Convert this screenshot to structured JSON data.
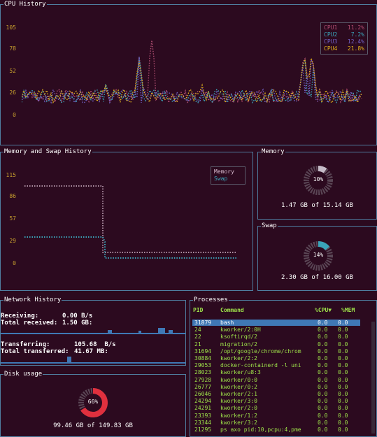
{
  "cpu": {
    "title": "CPU History",
    "yticks": [
      "105",
      "78",
      "52",
      "26",
      "0"
    ],
    "legend": [
      {
        "name": "CPU1",
        "value": "11.2%",
        "color": "#b14e72"
      },
      {
        "name": "CPU2",
        "value": "7.2%",
        "color": "#3aa3b8"
      },
      {
        "name": "CPU3",
        "value": "12.4%",
        "color": "#7161c4"
      },
      {
        "name": "CPU4",
        "value": "21.8%",
        "color": "#e0b01c"
      }
    ]
  },
  "memswap": {
    "title": "Memory and Swap History",
    "yticks": [
      "115",
      "86",
      "57",
      "29",
      "0"
    ],
    "legend": [
      {
        "name": "Memory",
        "color": "#d9bcd0"
      },
      {
        "name": "Swap",
        "color": "#3aa3b8"
      }
    ]
  },
  "memory": {
    "title": "Memory",
    "percent": "10%",
    "used": "1.47 GB of 15.14 GB",
    "fraction": 0.1,
    "color": "#c6bcc8"
  },
  "swap": {
    "title": "Swap",
    "percent": "14%",
    "used": "2.30 GB of 16.00 GB",
    "fraction": 0.14,
    "color": "#3aa3b8"
  },
  "network": {
    "title": "Network History",
    "receiving_label": "Receiving:",
    "receiving_value": "0.00 B/s",
    "total_received_label": "Total received:",
    "total_received_value": "1.50 GB:",
    "transferring_label": "Transferring:",
    "transferring_value": "105.68  B/s",
    "total_transferred_label": "Total transferred:",
    "total_transferred_value": "41.67 MB:"
  },
  "disk": {
    "title": "Disk usage",
    "percent": "66%",
    "used": "99.46 GB of 149.83 GB",
    "fraction": 0.66,
    "color": "#e0303e"
  },
  "processes": {
    "title": "Processes",
    "columns": {
      "pid": "PID",
      "command": "Command",
      "cpu": "%CPU▼",
      "mem": "%MEM"
    },
    "rows": [
      {
        "pid": "31879",
        "command": "bash",
        "cpu": "0.0",
        "mem": "0.0"
      },
      {
        "pid": "24",
        "command": "kworker/2:0H",
        "cpu": "0.0",
        "mem": "0.0"
      },
      {
        "pid": "22",
        "command": "ksoftirqd/2",
        "cpu": "0.0",
        "mem": "0.0"
      },
      {
        "pid": "21",
        "command": "migration/2",
        "cpu": "0.0",
        "mem": "0.0"
      },
      {
        "pid": "31694",
        "command": "/opt/google/chrome/chrom",
        "cpu": "0.0",
        "mem": "0.0"
      },
      {
        "pid": "30884",
        "command": "kworker/2:2",
        "cpu": "0.0",
        "mem": "0.0"
      },
      {
        "pid": "29053",
        "command": "docker-containerd -l uni",
        "cpu": "0.0",
        "mem": "0.0"
      },
      {
        "pid": "28023",
        "command": "kworker/u8:3",
        "cpu": "0.0",
        "mem": "0.0"
      },
      {
        "pid": "27928",
        "command": "kworker/0:0",
        "cpu": "0.0",
        "mem": "0.0"
      },
      {
        "pid": "26777",
        "command": "kworker/0:2",
        "cpu": "0.0",
        "mem": "0.0"
      },
      {
        "pid": "26046",
        "command": "kworker/2:1",
        "cpu": "0.0",
        "mem": "0.0"
      },
      {
        "pid": "24294",
        "command": "kworker/3:0",
        "cpu": "0.0",
        "mem": "0.0"
      },
      {
        "pid": "24291",
        "command": "kworker/2:0",
        "cpu": "0.0",
        "mem": "0.0"
      },
      {
        "pid": "23393",
        "command": "kworker/1:2",
        "cpu": "0.0",
        "mem": "0.0"
      },
      {
        "pid": "23344",
        "command": "kworker/3:2",
        "cpu": "0.0",
        "mem": "0.0"
      },
      {
        "pid": "21295",
        "command": "ps axo pid:10,pcpu:4,pme",
        "cpu": "0.0",
        "mem": "0.0"
      }
    ]
  }
}
